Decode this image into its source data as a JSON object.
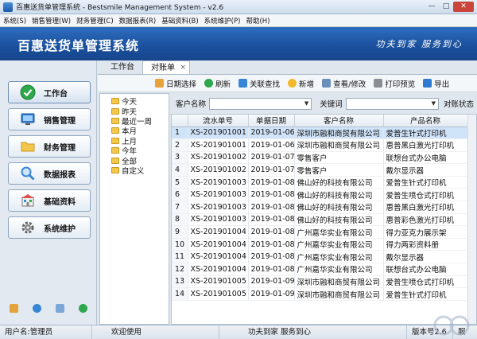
{
  "window": {
    "title": "百惠送货单管理系统 - Bestsmile Management System - v2.6",
    "minimize": "—",
    "maximize": "□",
    "close": "✕"
  },
  "menu": [
    "系统(S)",
    "销售管理(W)",
    "财务管理(C)",
    "数据报表(R)",
    "基础资料(B)",
    "系统维护(P)",
    "帮助(H)"
  ],
  "banner": {
    "title": "百惠送货单管理系统",
    "slogan": "功夫到家 服务到心"
  },
  "nav": [
    {
      "label": "工作台",
      "icon": "check-circle-icon",
      "color": "#2ea84a"
    },
    {
      "label": "销售管理",
      "icon": "monitor-icon",
      "color": "#2f7bd0"
    },
    {
      "label": "财务管理",
      "icon": "folder-icon",
      "color": "#f2c74a"
    },
    {
      "label": "数据报表",
      "icon": "magnifier-icon",
      "color": "#3a86d6"
    },
    {
      "label": "基础资料",
      "icon": "building-icon",
      "color": "#d9534f"
    },
    {
      "label": "系统维护",
      "icon": "gear-icon",
      "color": "#666666"
    }
  ],
  "tabs": {
    "workbench": "工作台",
    "statement": "对账单",
    "close": "×"
  },
  "toolbar": {
    "date_select": "日期选择",
    "refresh": "刷新",
    "linked_search": "关联查找",
    "add": "新增",
    "view_edit": "查看/修改",
    "print_preview": "打印预览",
    "export": "导出"
  },
  "tree": [
    "今天",
    "昨天",
    "最近一周",
    "本月",
    "上月",
    "今年",
    "全部",
    "自定义"
  ],
  "filter": {
    "customer_label": "客户名称",
    "customer_value": "",
    "keyword_label": "关键词",
    "keyword_value": "",
    "status_label": "对账状态"
  },
  "table": {
    "headers": [
      "",
      "流水单号",
      "单据日期",
      "客户名称",
      "产品名称"
    ],
    "rows": [
      [
        "1",
        "XS-201901001",
        "2019-01-06",
        "深圳市融和商贸有限公司",
        "爱普生针式打印机"
      ],
      [
        "2",
        "XS-201901001",
        "2019-01-06",
        "深圳市融和商贸有限公司",
        "惠普黑白激光打印机"
      ],
      [
        "3",
        "XS-201901002",
        "2019-01-07",
        "零售客户",
        "联想台式办公电脑"
      ],
      [
        "4",
        "XS-201901002",
        "2019-01-07",
        "零售客户",
        "戴尔显示器"
      ],
      [
        "5",
        "XS-201901003",
        "2019-01-08",
        "佛山好的科技有限公司",
        "爱普生针式打印机"
      ],
      [
        "6",
        "XS-201901003",
        "2019-01-08",
        "佛山好的科技有限公司",
        "爱普生喷仓式打印机"
      ],
      [
        "7",
        "XS-201901003",
        "2019-01-08",
        "佛山好的科技有限公司",
        "惠普黑白激光打印机"
      ],
      [
        "8",
        "XS-201901003",
        "2019-01-08",
        "佛山好的科技有限公司",
        "惠普彩色激光打印机"
      ],
      [
        "9",
        "XS-201901004",
        "2019-01-08",
        "广州嘉华实业有限公司",
        "得力亚克力展示架"
      ],
      [
        "10",
        "XS-201901004",
        "2019-01-08",
        "广州嘉华实业有限公司",
        "得力两彩资料册"
      ],
      [
        "11",
        "XS-201901004",
        "2019-01-08",
        "广州嘉华实业有限公司",
        "戴尔显示器"
      ],
      [
        "12",
        "XS-201901004",
        "2019-01-08",
        "广州嘉华实业有限公司",
        "联想台式办公电脑"
      ],
      [
        "13",
        "XS-201901005",
        "2019-01-09",
        "深圳市融和商贸有限公司",
        "爱普生喷仓式打印机"
      ],
      [
        "14",
        "XS-201901005",
        "2019-01-09",
        "深圳市融和商贸有限公司",
        "爱普生针式打印机"
      ]
    ]
  },
  "status": {
    "user": "用户名:管理员",
    "welcome": "欢迎使用",
    "slogan": "功夫到家 服务到心",
    "version": "版本号2.6",
    "extra": "服"
  }
}
